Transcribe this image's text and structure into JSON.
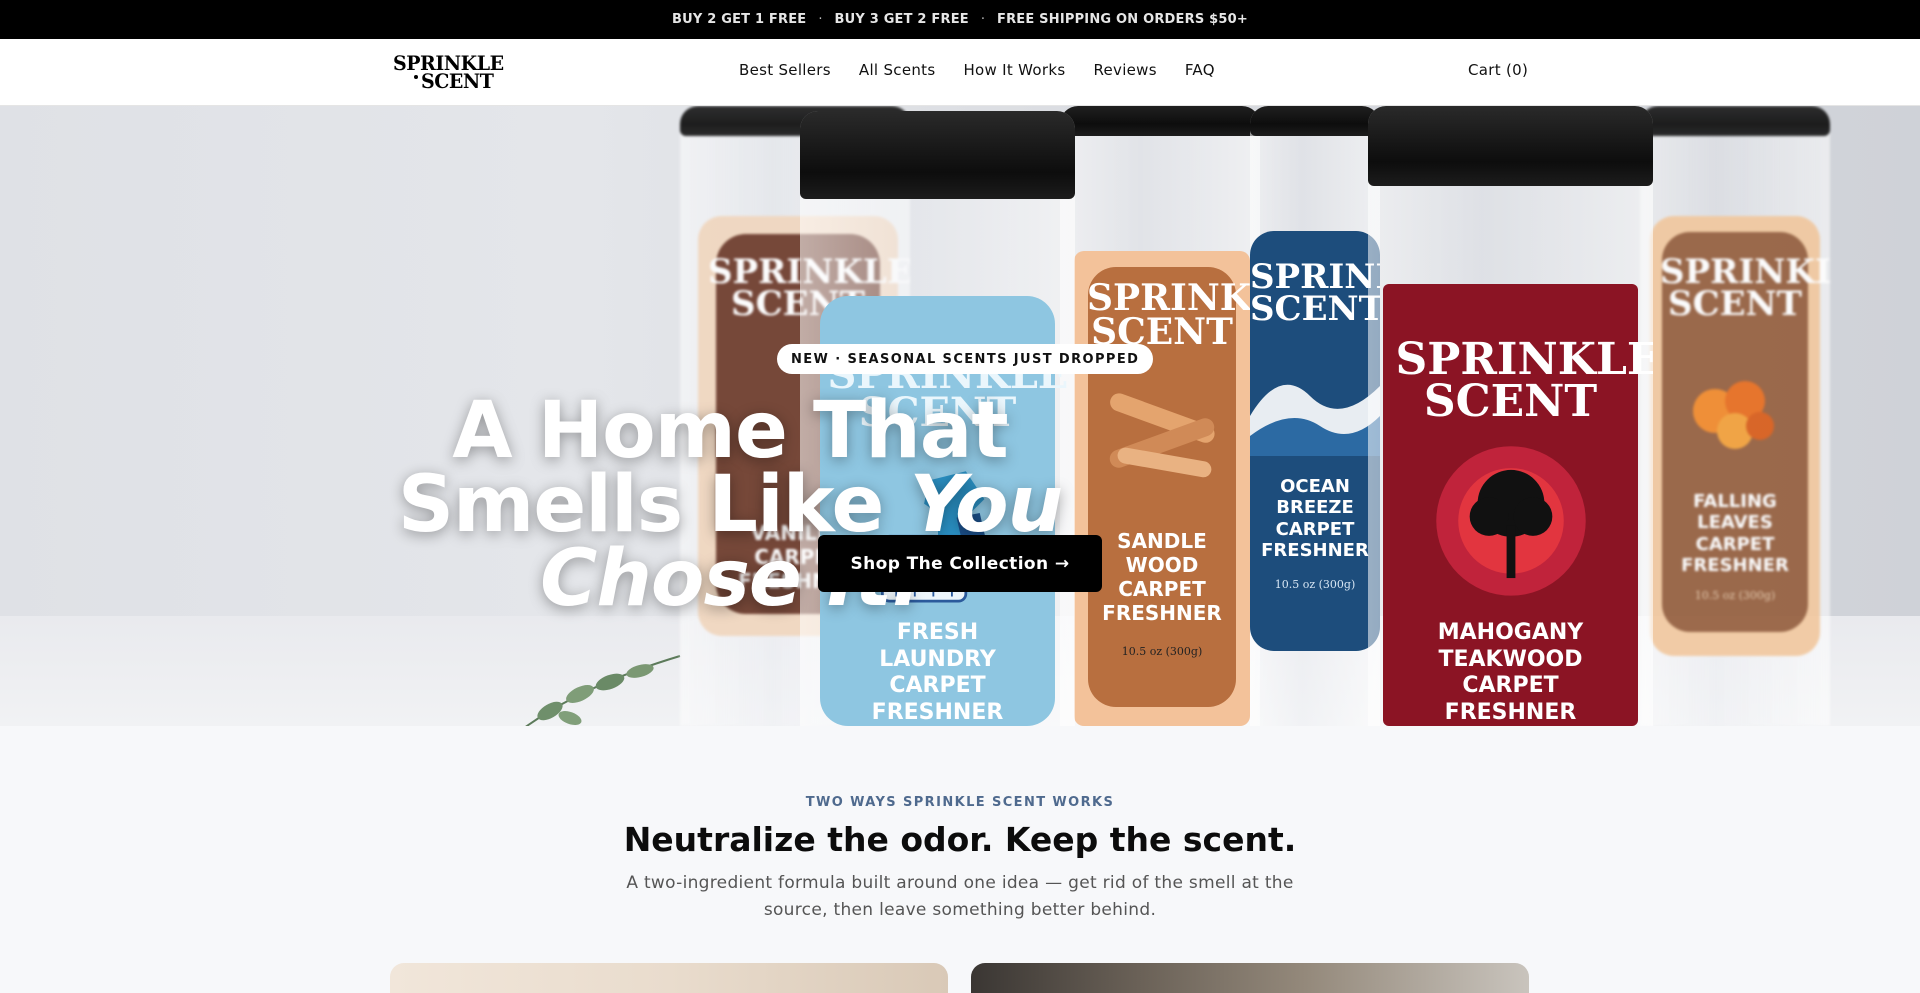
{
  "announcement": {
    "items": [
      "BUY 2 GET 1 FREE",
      "BUY 3 GET 2 FREE",
      "FREE SHIPPING ON ORDERS $50+"
    ],
    "separator": "·"
  },
  "header": {
    "logo_line1": "SPRINKLE",
    "logo_line2": "SCENT",
    "nav": [
      "Best Sellers",
      "All Scents",
      "How It Works",
      "Reviews",
      "FAQ"
    ],
    "cart_label": "Cart (0)"
  },
  "hero": {
    "badge": "NEW · SEASONAL SCENTS JUST DROPPED",
    "headline_line1": "A Home That",
    "headline_line2a": "Smells Like ",
    "headline_line2b": "You",
    "headline_line3": "Chose It.",
    "cta_label": "Shop The Collection →",
    "products": [
      {
        "brand": "SPRINKLE SCENT",
        "name": "VANILLA CARPET FRESHNER",
        "color": "#6e3b2b"
      },
      {
        "brand": "SPRINKLE SCENT",
        "name": "FRESH LAUNDRY CARPET FRESHNER",
        "color": "#8cc4df"
      },
      {
        "brand": "SPRINKLE SCENT",
        "name": "SANDLE WOOD CARPET FRESHNER",
        "weight": "10.5 oz (300g)",
        "color": "#c0743f"
      },
      {
        "brand": "SPRINKLE SCENT",
        "name": "OCEAN BREEZE CARPET FRESHNER",
        "weight": "10.5 oz (300g)",
        "color": "#1f4f7f"
      },
      {
        "brand": "SPRINKLE SCENT",
        "name": "MAHOGANY TEAKWOOD CARPET FRESHNER",
        "color": "#8b1424"
      },
      {
        "brand": "SPRINKLE SCENT",
        "name": "FALLING LEAVES CARPET FRESHNER",
        "weight": "10.5 oz (300g)",
        "color": "#8f5a3a"
      }
    ]
  },
  "section": {
    "eyebrow": "TWO WAYS SPRINKLE SCENT WORKS",
    "title": "Neutralize the odor. Keep the scent.",
    "subtitle": "A two-ingredient formula built around one idea — get rid of the smell at the source, then leave something better behind."
  },
  "colors": {
    "announcement_bg": "#000000",
    "eyebrow": "#4f6a8e",
    "cta_bg": "#000000"
  }
}
